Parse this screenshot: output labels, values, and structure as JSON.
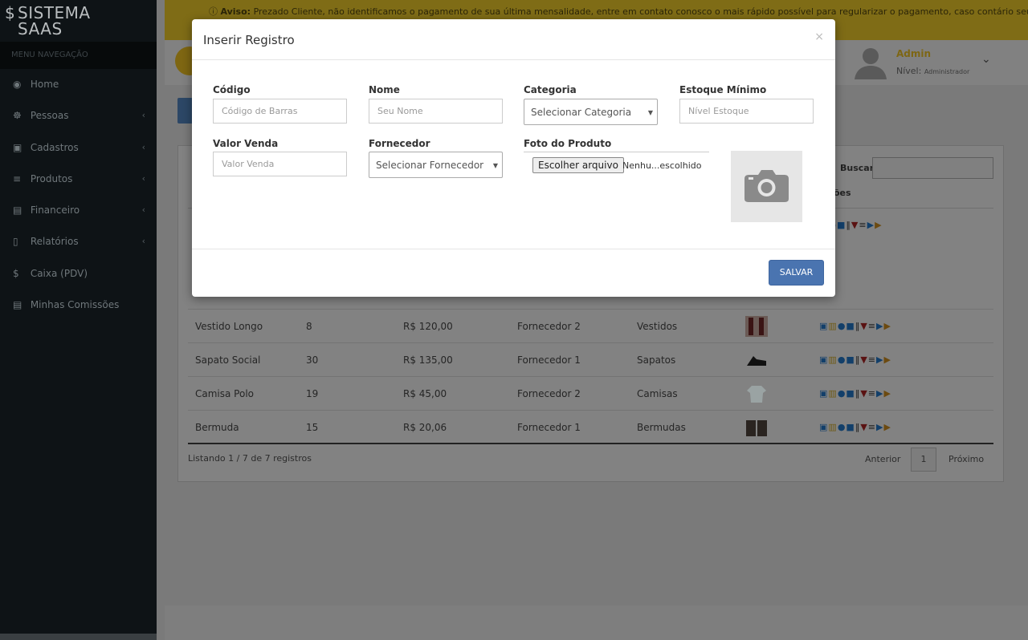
{
  "brand": {
    "line1": "SISTEMA",
    "line2": "SAAS",
    "symbol": "$"
  },
  "sidebar": {
    "header": "MENU NAVEGAÇÃO",
    "items": [
      {
        "label": "Home",
        "icon": "dashboard-icon",
        "glyph": "◉",
        "has_submenu": false
      },
      {
        "label": "Pessoas",
        "icon": "users-icon",
        "glyph": "☸",
        "has_submenu": true
      },
      {
        "label": "Cadastros",
        "icon": "save-icon",
        "glyph": "▣",
        "has_submenu": true
      },
      {
        "label": "Produtos",
        "icon": "cart-icon",
        "glyph": "≡",
        "has_submenu": true
      },
      {
        "label": "Financeiro",
        "icon": "money-icon",
        "glyph": "▤",
        "has_submenu": true
      },
      {
        "label": "Relatórios",
        "icon": "file-icon",
        "glyph": "▯",
        "has_submenu": true
      },
      {
        "label": "Caixa (PDV)",
        "icon": "dollar-icon",
        "glyph": "$",
        "has_submenu": false
      },
      {
        "label": "Minhas Comissões",
        "icon": "money-icon",
        "glyph": "▤",
        "has_submenu": false
      }
    ]
  },
  "notice": {
    "label": "Aviso:",
    "text": "Prezado Cliente, não identificamos o pagamento de sua última mensalidade, entre em contato conosco o mais rápido possível para regularizar o pagamento, caso contário seu"
  },
  "user": {
    "name": "Admin",
    "level_label": "Nível:",
    "level_value": "Administrador"
  },
  "table": {
    "search_label": "Buscar:",
    "actions_header": "ões",
    "rows": [
      {
        "name": "Vestido Longo",
        "stock": "8",
        "price": "R$ 120,00",
        "supplier": "Fornecedor 2",
        "category": "Vestidos",
        "image": "dress-image"
      },
      {
        "name": "Sapato Social",
        "stock": "30",
        "price": "R$ 135,00",
        "supplier": "Fornecedor 1",
        "category": "Sapatos",
        "image": "shoe-image"
      },
      {
        "name": "Camisa Polo",
        "stock": "19",
        "price": "R$ 45,00",
        "supplier": "Fornecedor 2",
        "category": "Camisas",
        "image": "shirt-image"
      },
      {
        "name": "Bermuda",
        "stock": "15",
        "price": "R$ 20,06",
        "supplier": "Fornecedor 1",
        "category": "Bermudas",
        "image": "shorts-image"
      }
    ],
    "listing_text": "Listando 1 / 7 de 7 registros",
    "prev_label": "Anterior",
    "page": "1",
    "next_label": "Próximo"
  },
  "modal": {
    "title": "Inserir Registro",
    "close": "×",
    "fields": {
      "codigo": {
        "label": "Código",
        "placeholder": "Código de Barras"
      },
      "nome": {
        "label": "Nome",
        "placeholder": "Seu Nome"
      },
      "categoria": {
        "label": "Categoria",
        "value": "Selecionar Categoria"
      },
      "estoque": {
        "label": "Estoque Mínimo",
        "placeholder": "Nível Estoque"
      },
      "valor": {
        "label": "Valor Venda",
        "placeholder": "Valor Venda"
      },
      "fornecedor": {
        "label": "Fornecedor",
        "value": "Selecionar Fornecedor"
      },
      "foto": {
        "label": "Foto do Produto",
        "button": "Escolher arquivo",
        "status": "Nenhu...escolhido"
      }
    },
    "save_label": "SALVAR"
  },
  "colors": {
    "accent": "#f5c518",
    "primary": "#4a74b0",
    "sidebar": "#222d32"
  }
}
